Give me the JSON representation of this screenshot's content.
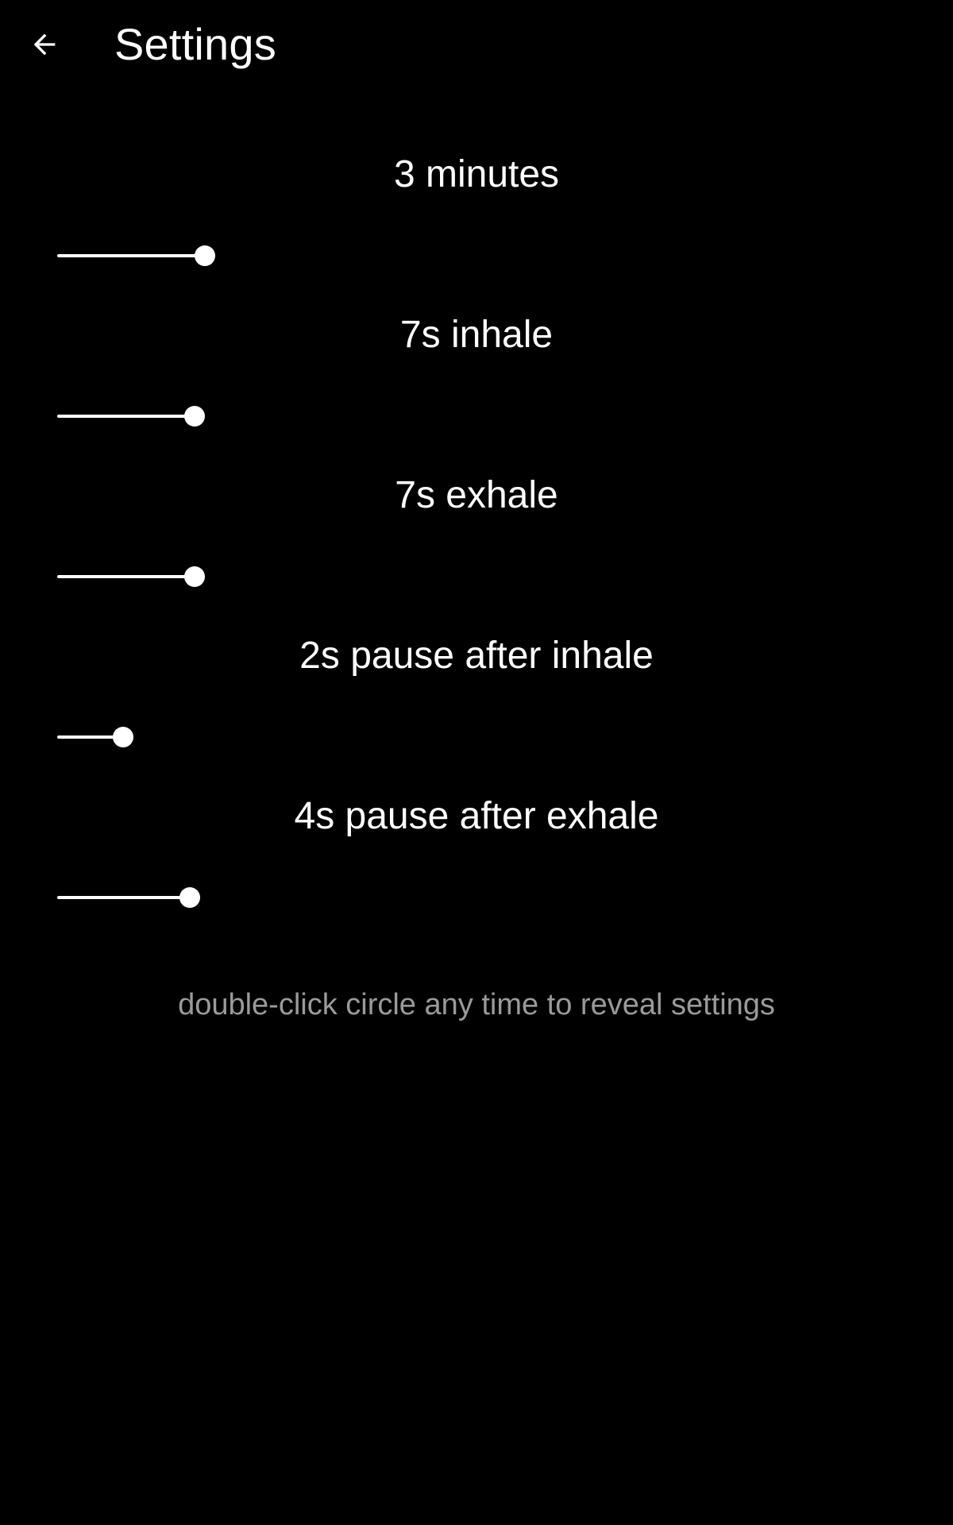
{
  "header": {
    "back_icon": "arrow-left-icon",
    "title": "Settings"
  },
  "settings": [
    {
      "label": "3 minutes",
      "fraction": 0.176
    },
    {
      "label": "7s inhale",
      "fraction": 0.164
    },
    {
      "label": "7s exhale",
      "fraction": 0.164
    },
    {
      "label": "2s pause after inhale",
      "fraction": 0.079
    },
    {
      "label": "4s pause after exhale",
      "fraction": 0.158
    }
  ],
  "hint": "double-click circle any time to reveal settings",
  "colors": {
    "background": "#000000",
    "foreground": "#ffffff",
    "hint": "#9a9a9a"
  }
}
